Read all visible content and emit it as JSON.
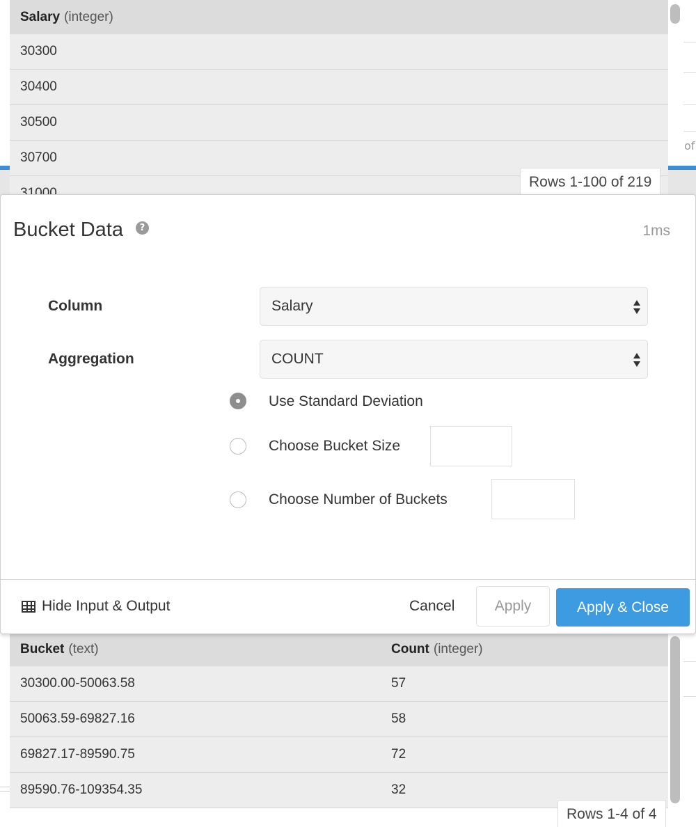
{
  "top_table": {
    "column_name": "Salary",
    "column_type": "(integer)",
    "rows": [
      "30300",
      "30400",
      "30500",
      "30700",
      "31000"
    ],
    "rows_badge": "Rows 1-100 of 219"
  },
  "background": {
    "cut_text": "of"
  },
  "modal": {
    "title": "Bucket Data",
    "help_icon": "question-circle-icon",
    "timing": "1ms",
    "column_label": "Column",
    "column_value": "Salary",
    "aggregation_label": "Aggregation",
    "aggregation_value": "COUNT",
    "options": {
      "std_dev": "Use Standard Deviation",
      "bucket_size": "Choose Bucket Size",
      "num_buckets": "Choose Number of Buckets"
    },
    "selected_option": "std_dev",
    "bucket_size_value": "",
    "num_buckets_value": "",
    "footer": {
      "hide_io": "Hide Input & Output",
      "hide_io_icon": "table-icon",
      "cancel": "Cancel",
      "apply": "Apply",
      "apply_close": "Apply & Close"
    }
  },
  "bottom_table": {
    "columns": [
      {
        "name": "Bucket",
        "type": "(text)"
      },
      {
        "name": "Count",
        "type": "(integer)"
      }
    ],
    "rows": [
      [
        "30300.00-50063.58",
        "57"
      ],
      [
        "50063.59-69827.16",
        "58"
      ],
      [
        "69827.17-89590.75",
        "72"
      ],
      [
        "89590.76-109354.35",
        "32"
      ]
    ],
    "rows_badge": "Rows 1-4 of 4"
  },
  "colors": {
    "primary": "#3d9be1",
    "accent_bar": "#3a8fd6",
    "header_bg": "#dcdcdc",
    "row_bg": "#ededed"
  }
}
